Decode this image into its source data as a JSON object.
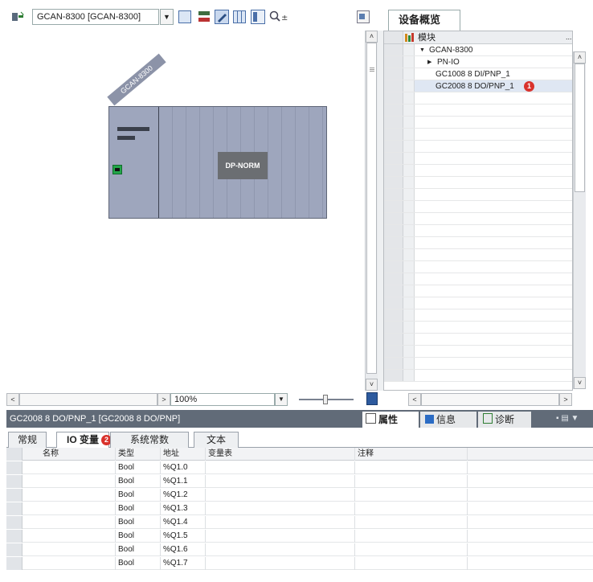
{
  "toolbar": {
    "device_combo": "GCAN-8300 [GCAN-8300]",
    "icons": [
      "network-view-icon",
      "device-list-icon",
      "swap-icon",
      "edit-icon",
      "grid-icon",
      "properties-icon",
      "zoom-icon",
      "overview-icon"
    ]
  },
  "canvas": {
    "rack_label": "GCAN-8300",
    "module_label": "DP-NORM",
    "zoom": "100%"
  },
  "overview": {
    "tab_title": "设备概览",
    "header": "模块",
    "header_more": "...",
    "items": [
      {
        "label": "GCAN-8300",
        "expander": "▼"
      },
      {
        "label": "PN-IO",
        "expander": "▶"
      },
      {
        "label": "GC1008 8 DI/PNP_1",
        "expander": ""
      },
      {
        "label": "GC2008 8 DO/PNP_1",
        "expander": "",
        "badge": "1"
      }
    ]
  },
  "inspector": {
    "title": "GC2008 8 DO/PNP_1 [GC2008 8 DO/PNP]",
    "right_tabs": [
      {
        "label": "属性",
        "icon": "properties-icon"
      },
      {
        "label": "信息",
        "icon": "info-icon"
      },
      {
        "label": "诊断",
        "icon": "diagnostics-icon"
      }
    ],
    "tabs": [
      {
        "label": "常规"
      },
      {
        "label": "IO 变量",
        "badge": "2"
      },
      {
        "label": "系统常数"
      },
      {
        "label": "文本"
      }
    ],
    "columns": [
      "名称",
      "类型",
      "地址",
      "变量表",
      "注释"
    ],
    "rows": [
      {
        "name": "",
        "type": "Bool",
        "address": "%Q1.0",
        "table": "",
        "comment": ""
      },
      {
        "name": "",
        "type": "Bool",
        "address": "%Q1.1",
        "table": "",
        "comment": ""
      },
      {
        "name": "",
        "type": "Bool",
        "address": "%Q1.2",
        "table": "",
        "comment": ""
      },
      {
        "name": "",
        "type": "Bool",
        "address": "%Q1.3",
        "table": "",
        "comment": ""
      },
      {
        "name": "",
        "type": "Bool",
        "address": "%Q1.4",
        "table": "",
        "comment": ""
      },
      {
        "name": "",
        "type": "Bool",
        "address": "%Q1.5",
        "table": "",
        "comment": ""
      },
      {
        "name": "",
        "type": "Bool",
        "address": "%Q1.6",
        "table": "",
        "comment": ""
      },
      {
        "name": "",
        "type": "Bool",
        "address": "%Q1.7",
        "table": "",
        "comment": ""
      }
    ]
  },
  "colors": {
    "accent_badge": "#d9322c",
    "title_bar": "#616b78",
    "rack_body": "#9ea6bd",
    "module_box": "#6b6e72",
    "selected_row": "#dfe7f3"
  }
}
